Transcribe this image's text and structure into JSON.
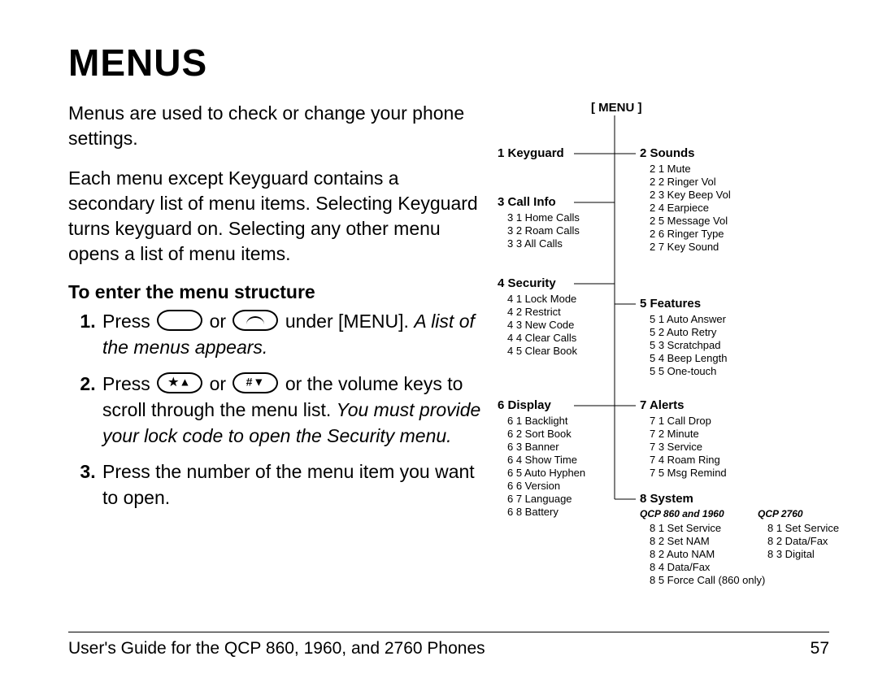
{
  "title": "MENUS",
  "intro1": "Menus are used to check or change your phone settings.",
  "intro2": "Each menu except Keyguard contains a secondary list of menu items. Selecting Keyguard turns keyguard on. Selecting any other menu opens a list of menu items.",
  "subhead": "To enter the menu structure",
  "step1a": "Press ",
  "step1b": " or ",
  "step1c": " under [MENU]. ",
  "step1d": "A list of the menus appears.",
  "step2a": "Press ",
  "step2b": " or ",
  "step2c": " or the volume keys to scroll through the menu list. ",
  "step2d": "You must provide your lock code to open the Security menu.",
  "step3": "Press the number of the menu item you want to open.",
  "menu_root": "[ MENU ]",
  "tree": {
    "keyguard": "1 Keyguard",
    "sounds": "2 Sounds",
    "sounds_items": [
      "2 1 Mute",
      "2 2 Ringer Vol",
      "2 3 Key Beep Vol",
      "2 4 Earpiece",
      "2 5 Message Vol",
      "2 6 Ringer Type",
      "2 7 Key Sound"
    ],
    "callinfo": "3 Call Info",
    "callinfo_items": [
      "3 1 Home Calls",
      "3 2 Roam Calls",
      "3 3 All Calls"
    ],
    "security": "4 Security",
    "security_items": [
      "4 1 Lock Mode",
      "4 2 Restrict",
      "4 3 New Code",
      "4 4 Clear Calls",
      "4 5 Clear Book"
    ],
    "features": "5 Features",
    "features_items": [
      "5 1 Auto Answer",
      "5 2 Auto Retry",
      "5 3 Scratchpad",
      "5 4 Beep Length",
      "5 5 One-touch"
    ],
    "display": "6 Display",
    "display_items": [
      "6 1 Backlight",
      "6 2 Sort Book",
      "6 3 Banner",
      "6 4 Show Time",
      "6 5 Auto Hyphen",
      "6 6 Version",
      "6 7 Language",
      "6 8 Battery"
    ],
    "alerts": "7 Alerts",
    "alerts_items": [
      "7 1 Call Drop",
      "7 2 Minute",
      "7 3 Service",
      "7 4 Roam Ring",
      "7 5 Msg Remind"
    ],
    "system": "8 System",
    "sys_label_a": "QCP 860 and 1960",
    "sys_label_b": "QCP 2760",
    "system_a": [
      "8 1 Set Service",
      "8 2 Set NAM",
      "8 2 Auto NAM",
      "8 4 Data/Fax",
      "8 5 Force Call (860 only)"
    ],
    "system_b": [
      "8 1 Set Service",
      "8 2 Data/Fax",
      "8 3 Digital"
    ]
  },
  "footer_left": "User's Guide for the QCP 860, 1960, and 2760 Phones",
  "footer_right": "57"
}
